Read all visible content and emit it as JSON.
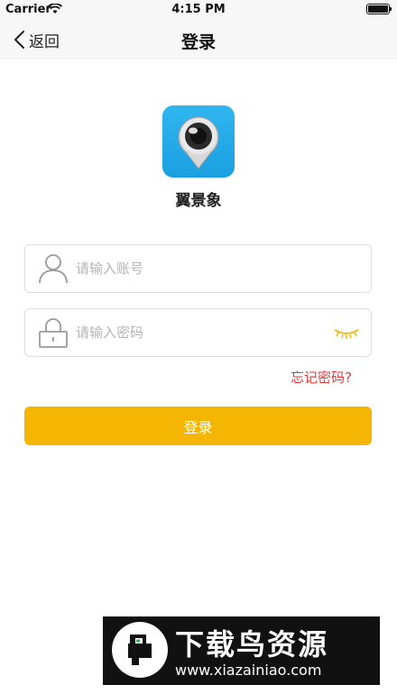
{
  "status_bar": {
    "carrier": "Carrier",
    "time": "4:15 PM",
    "icons": [
      "wifi-icon",
      "battery-icon"
    ]
  },
  "nav": {
    "back_label": "返回",
    "title": "登录"
  },
  "app": {
    "name": "翼景象",
    "logo_icon": "camera-pin-logo"
  },
  "form": {
    "account": {
      "placeholder": "请输入账号",
      "value": "",
      "icon": "user-icon"
    },
    "password": {
      "placeholder": "请输入密码",
      "value": "",
      "icon": "lock-icon",
      "toggle_icon": "eye-closed-icon"
    },
    "forgot_label": "忘记密码?",
    "login_label": "登录"
  },
  "watermark": {
    "title": "下载鸟资源",
    "url": "www.xiazainiao.com"
  },
  "colors": {
    "accent": "#f5b602",
    "link": "#e03a3a",
    "logo_bg": "#1a9fe0"
  }
}
